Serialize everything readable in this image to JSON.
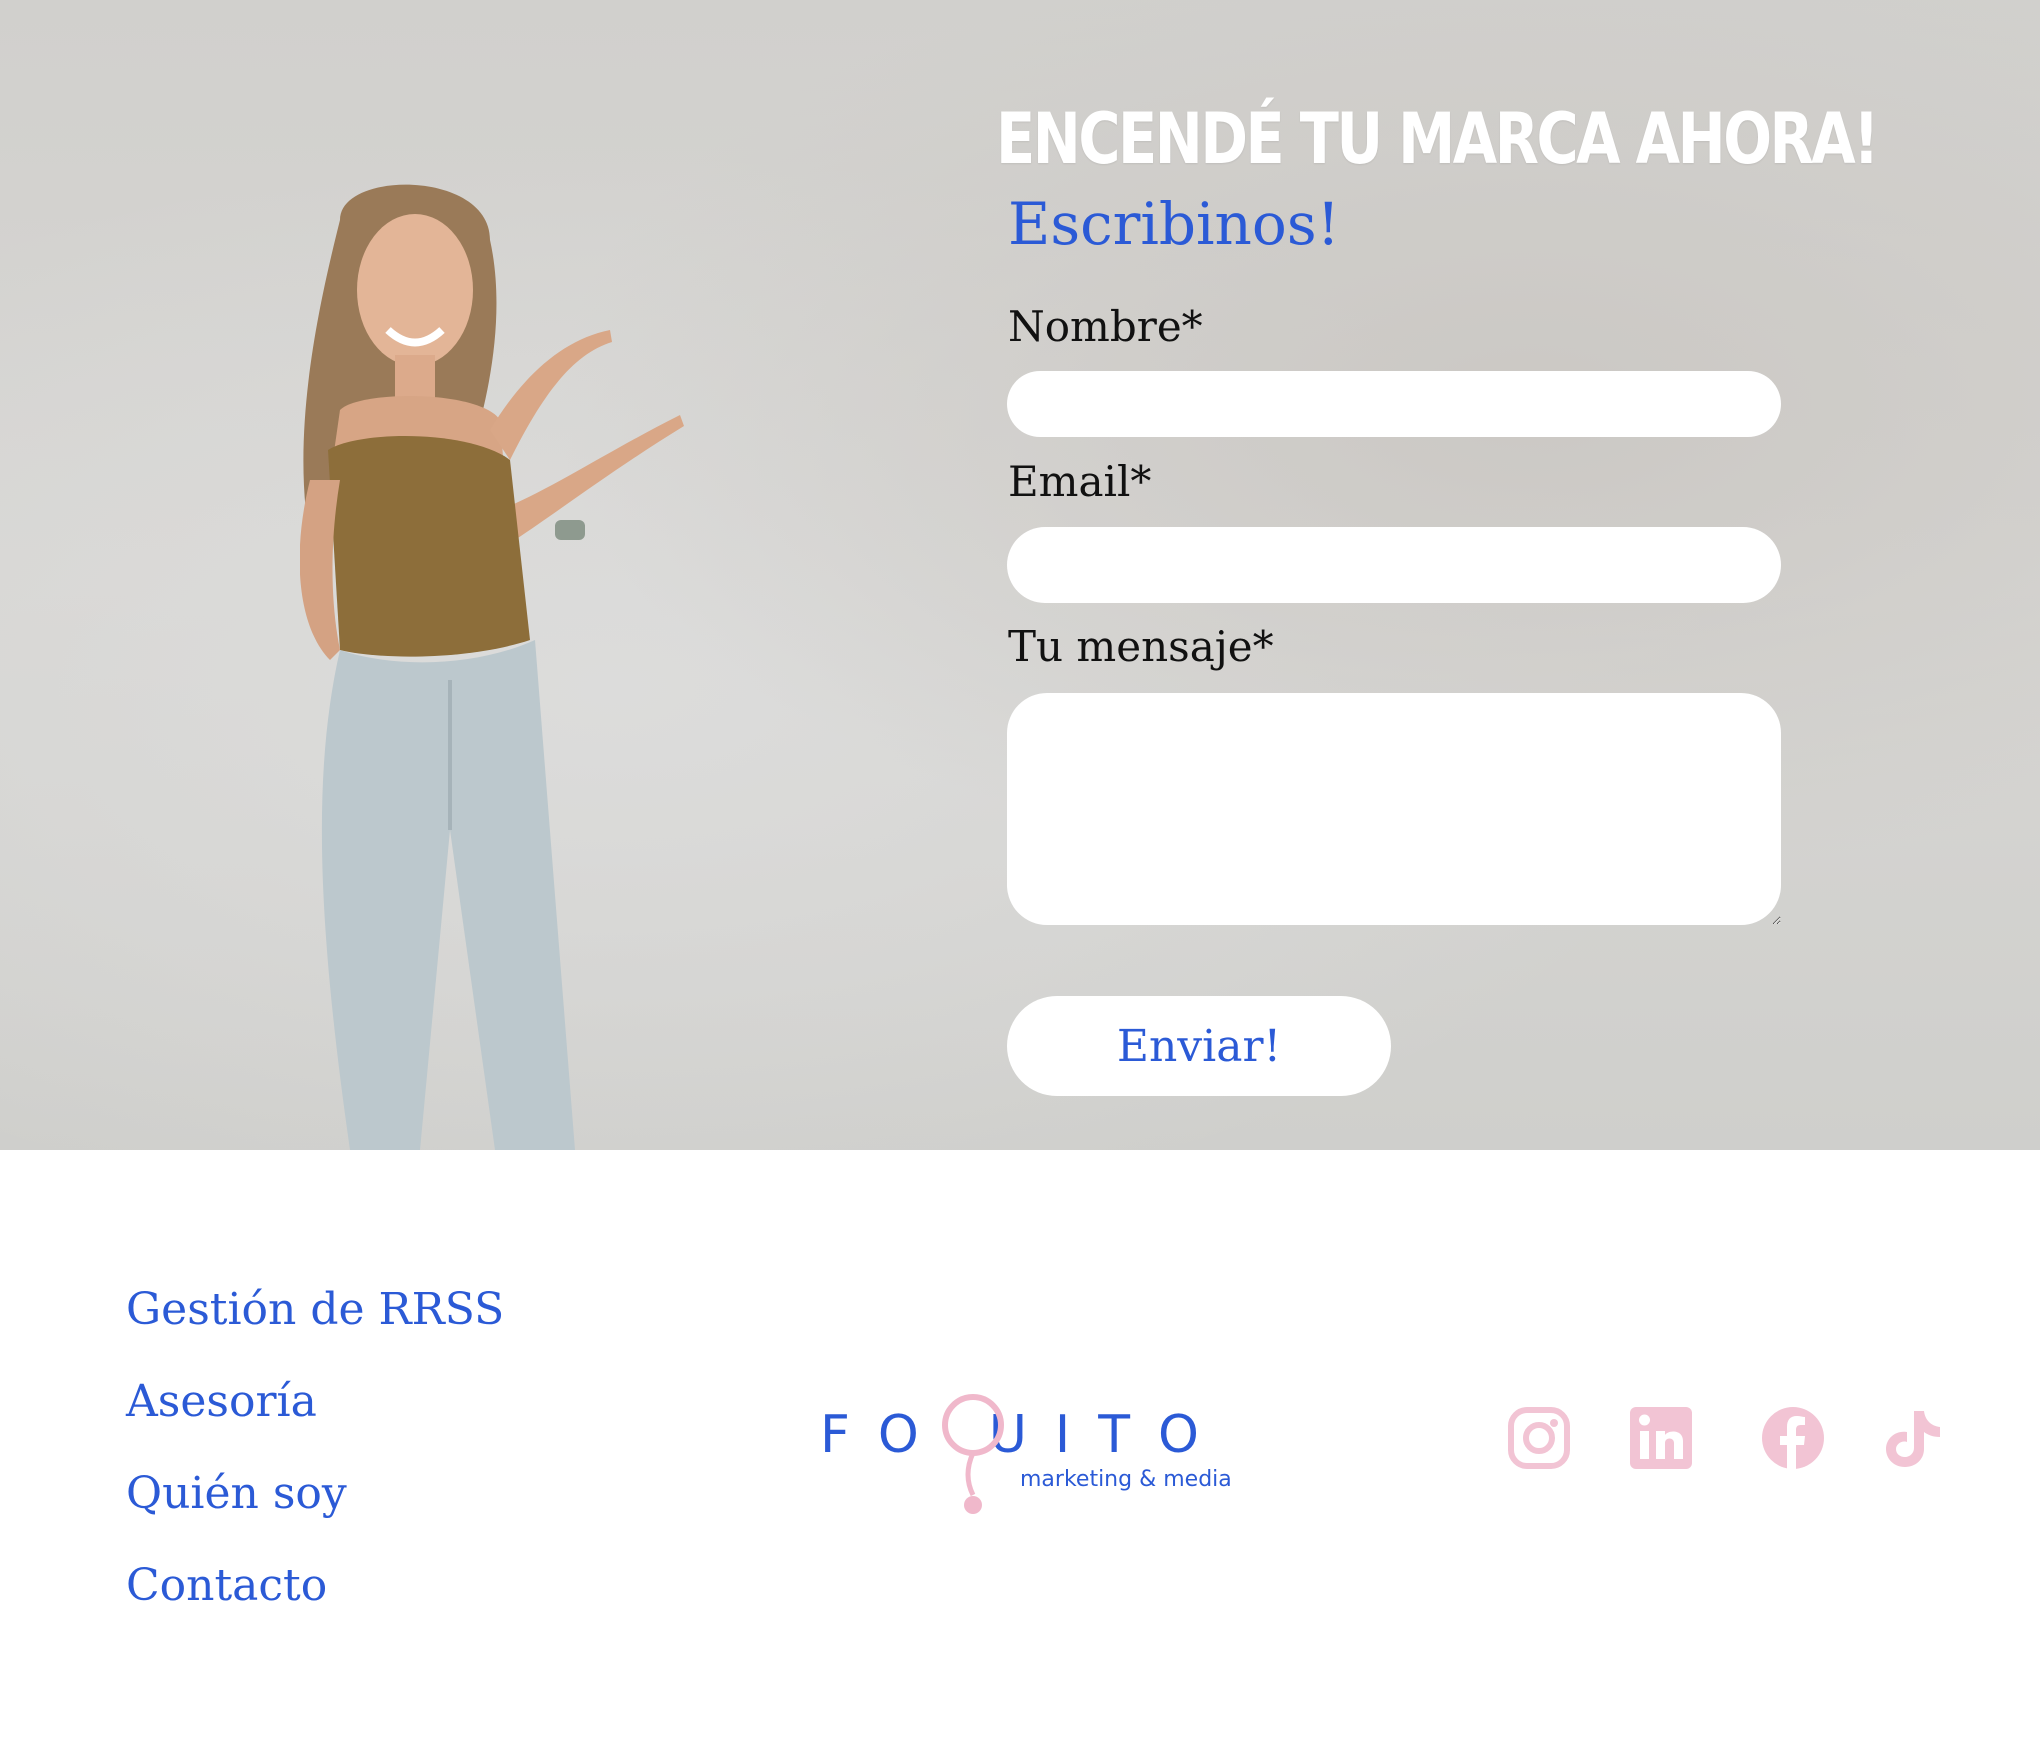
{
  "hero": {
    "headline": "ENCENDÉ TU MARCA AHORA!",
    "subheading": "Escribinos!"
  },
  "form": {
    "name_label": "Nombre*",
    "name_value": "",
    "email_label": "Email*",
    "email_value": "",
    "message_label": "Tu mensaje*",
    "message_value": "",
    "submit_label": "Enviar!"
  },
  "footer": {
    "links": [
      "Gestión de RRSS",
      "Asesoría",
      "Quién soy",
      "Contacto"
    ],
    "logo": {
      "word_left": "FO",
      "word_right": "UITO",
      "tagline": "marketing & media"
    },
    "social": [
      "instagram-icon",
      "linkedin-icon",
      "facebook-icon",
      "tiktok-icon"
    ]
  },
  "colors": {
    "accent_blue": "#2b5ad6",
    "social_pink": "#f2c4d4",
    "hero_gray": "#d3d2cf"
  }
}
